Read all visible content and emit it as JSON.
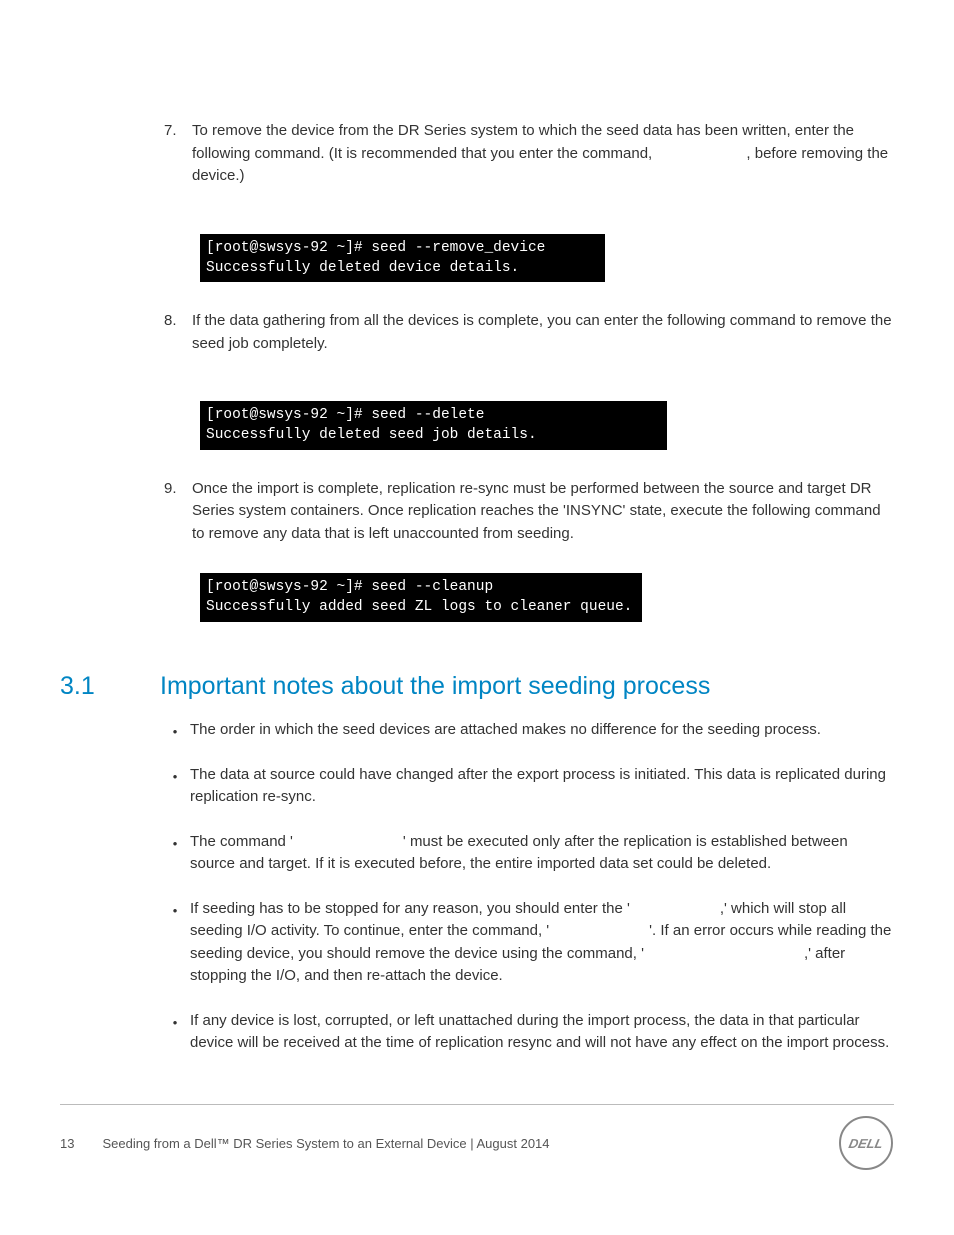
{
  "steps": {
    "s7": {
      "num": "7.",
      "text_a": "To remove the device from the DR Series system to which the seed data has been written, enter the following command. (It is recommended that you enter the command, ",
      "text_b": ", before removing the device.)"
    },
    "s8": {
      "num": "8.",
      "text": "If the data gathering from all the devices is complete, you can enter the following command to remove the seed job completely."
    },
    "s9": {
      "num": "9.",
      "text": "Once the import is complete, replication re-sync must be performed between the source and target DR Series system containers. Once replication reaches the 'INSYNC' state, execute the following command to remove any data that is left unaccounted from seeding."
    }
  },
  "terminal": {
    "t1": "[root@swsys-92 ~]# seed --remove_device\nSuccessfully deleted device details.",
    "t2": "[root@swsys-92 ~]# seed --delete\nSuccessfully deleted seed job details.",
    "t3": "[root@swsys-92 ~]# seed --cleanup\nSuccessfully added seed ZL logs to cleaner queue."
  },
  "section": {
    "num": "3.1",
    "title": "Important notes about the import seeding process"
  },
  "bullets": {
    "b1": "The order in which the seed devices are attached makes no difference for the seeding process.",
    "b2": "The data at source could have changed after the export process is initiated. This data is replicated during replication re-sync.",
    "b3a": "The command '",
    "b3b": "' must be executed only after the replication is established between source and target. If it is executed before, the entire imported data set could be deleted.",
    "b4a": "If seeding has to be stopped for any reason, you should enter the '",
    "b4b": ",' which will stop all seeding I/O activity. To continue, enter the command, '",
    "b4c": "'. If an error occurs while reading the seeding device, you should remove the device using the command, '",
    "b4d": ",' after stopping the I/O, and then re-attach the device.",
    "b5": "If any device is lost, corrupted, or left unattached during the import process, the data in that particular device will be received at the time of replication resync and will not have any effect on the import process."
  },
  "footer": {
    "page": "13",
    "title": "Seeding from a Dell™ DR Series System to an External Device | August 2014"
  }
}
